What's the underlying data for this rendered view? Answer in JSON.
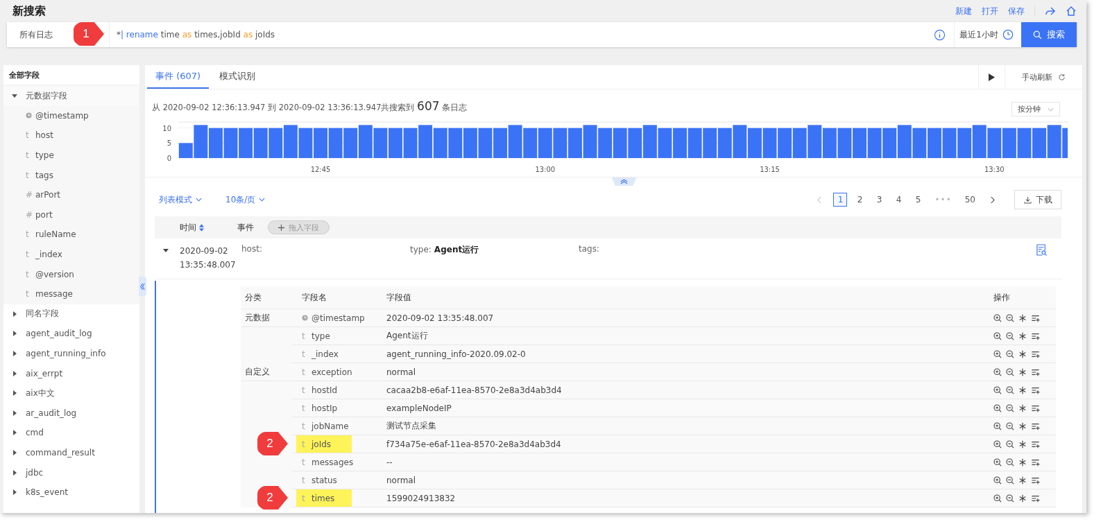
{
  "page": {
    "title": "新搜索",
    "actions": [
      "新建",
      "打开",
      "保存"
    ]
  },
  "search": {
    "source": "所有日志",
    "callout": "1",
    "query": [
      {
        "kind": "plain",
        "text": "*"
      },
      {
        "kind": "command",
        "text": "| rename"
      },
      {
        "kind": "plain",
        "text": " time "
      },
      {
        "kind": "keyword",
        "text": "as"
      },
      {
        "kind": "plain",
        "text": " times,jobId "
      },
      {
        "kind": "keyword",
        "text": "as"
      },
      {
        "kind": "plain",
        "text": " joIds"
      }
    ],
    "time_range": "最近1小时",
    "button": "搜索"
  },
  "sidebar": {
    "title": "全部字段",
    "groups": [
      {
        "label": "元数据字段",
        "expanded": true,
        "children": [
          {
            "kind": "time",
            "name": "@timestamp"
          },
          {
            "kind": "text",
            "mark": "t",
            "name": "host"
          },
          {
            "kind": "text",
            "mark": "t",
            "name": "type"
          },
          {
            "kind": "text",
            "mark": "t",
            "name": "tags"
          },
          {
            "kind": "text",
            "mark": "#",
            "name": "arPort"
          },
          {
            "kind": "text",
            "mark": "#",
            "name": "port"
          },
          {
            "kind": "text",
            "mark": "t",
            "name": "ruleName"
          },
          {
            "kind": "text",
            "mark": "t",
            "name": "_index"
          },
          {
            "kind": "text",
            "mark": "t",
            "name": "@version"
          },
          {
            "kind": "text",
            "mark": "t",
            "name": "message"
          }
        ]
      },
      {
        "label": "同名字段",
        "expanded": false
      },
      {
        "label": "agent_audit_log",
        "expanded": false
      },
      {
        "label": "agent_running_info",
        "expanded": false
      },
      {
        "label": "aix_errpt",
        "expanded": false
      },
      {
        "label": "aix中文",
        "expanded": false
      },
      {
        "label": "ar_audit_log",
        "expanded": false
      },
      {
        "label": "cmd",
        "expanded": false
      },
      {
        "label": "command_result",
        "expanded": false
      },
      {
        "label": "jdbc",
        "expanded": false
      },
      {
        "label": "k8s_event",
        "expanded": false
      }
    ]
  },
  "tabs": [
    {
      "label": "事件 (607)",
      "selected": true
    },
    {
      "label": "模式识别",
      "selected": false
    }
  ],
  "refresh": "手动刷新",
  "summary": {
    "prefix": "从 2020-09-02 12:36:13.947 到 2020-09-02 13:36:13.947共搜索到",
    "count": "607",
    "suffix": "条日志"
  },
  "interval": "按分钟",
  "chart_data": {
    "type": "bar",
    "ylim": [
      0,
      12
    ],
    "yticks": [
      0,
      5,
      10
    ],
    "categories": [
      null,
      null,
      null,
      null,
      null,
      null,
      null,
      null,
      null,
      "12:45",
      null,
      null,
      null,
      null,
      null,
      null,
      null,
      null,
      null,
      null,
      null,
      null,
      null,
      null,
      "13:00",
      null,
      null,
      null,
      null,
      null,
      null,
      null,
      null,
      null,
      null,
      null,
      null,
      null,
      null,
      "13:15",
      null,
      null,
      null,
      null,
      null,
      null,
      null,
      null,
      null,
      null,
      null,
      null,
      null,
      null,
      "13:30",
      null,
      null,
      null,
      null,
      null
    ],
    "values": [
      5,
      11,
      10,
      10,
      10,
      10,
      10,
      11,
      10,
      10,
      10,
      10,
      11,
      10,
      10,
      10,
      11,
      10,
      10,
      10,
      10,
      10,
      11,
      10,
      10,
      10,
      10,
      11,
      10,
      10,
      10,
      11,
      10,
      10,
      10,
      10,
      10,
      11,
      10,
      10,
      10,
      10,
      11,
      10,
      10,
      10,
      10,
      10,
      11,
      10,
      10,
      10,
      10,
      11,
      10,
      10,
      10,
      10,
      11,
      10
    ]
  },
  "list_controls": {
    "view": "列表模式",
    "page_size": "10条/页",
    "download": "下载"
  },
  "pager": {
    "prev_disabled": true,
    "pages": [
      {
        "kind": "page",
        "label": "1",
        "selected": true
      },
      {
        "kind": "page",
        "label": "2",
        "selected": false
      },
      {
        "kind": "page",
        "label": "3",
        "selected": false
      },
      {
        "kind": "page",
        "label": "4",
        "selected": false
      },
      {
        "kind": "page",
        "label": "5",
        "selected": false
      },
      {
        "kind": "ellipsis",
        "label": "•••"
      },
      {
        "kind": "page",
        "label": "50",
        "selected": false
      }
    ]
  },
  "table": {
    "columns": [
      "时间",
      "事件"
    ],
    "drag_field": "拖入字段",
    "event": {
      "expanded": true,
      "time": "2020-09-02 13:35:48.007",
      "fields": [
        {
          "key": "host:"
        },
        {
          "key": "type:",
          "value": "Agent运行"
        },
        {
          "key": "tags:"
        }
      ]
    }
  },
  "detail": {
    "columns": [
      "分类",
      "字段名",
      "字段值",
      "操作"
    ],
    "rows": [
      {
        "category": "元数据",
        "kind": "time",
        "name": "@timestamp",
        "value": "2020-09-02 13:35:48.007",
        "highlighted": false
      },
      {
        "kind": "text",
        "mark": "t",
        "name": "type",
        "value": "Agent运行",
        "highlighted": false
      },
      {
        "kind": "text",
        "mark": "t",
        "name": "_index",
        "value": "agent_running_info-2020.09.02-0",
        "highlighted": false
      },
      {
        "category": "自定义",
        "kind": "text",
        "mark": "t",
        "name": "exception",
        "value": "normal",
        "highlighted": false
      },
      {
        "kind": "text",
        "mark": "t",
        "name": "hostId",
        "value": "cacaa2b8-e6af-11ea-8570-2e8a3d4ab3d4",
        "highlighted": false
      },
      {
        "kind": "text",
        "mark": "t",
        "name": "hostIp",
        "value": "exampleNodeIP",
        "highlighted": false
      },
      {
        "kind": "text",
        "mark": "t",
        "name": "jobName",
        "value": "测试节点采集",
        "highlighted": false
      },
      {
        "kind": "text",
        "mark": "t",
        "name": "joIds",
        "value": "f734a75e-e6af-11ea-8570-2e8a3d4ab3d4",
        "highlighted": true,
        "callout": "2"
      },
      {
        "kind": "text",
        "mark": "t",
        "name": "messages",
        "value": "--",
        "highlighted": false
      },
      {
        "kind": "text",
        "mark": "t",
        "name": "status",
        "value": "normal",
        "highlighted": false
      },
      {
        "kind": "text",
        "mark": "t",
        "name": "times",
        "value": "1599024913832",
        "highlighted": true,
        "callout": "2"
      }
    ]
  }
}
